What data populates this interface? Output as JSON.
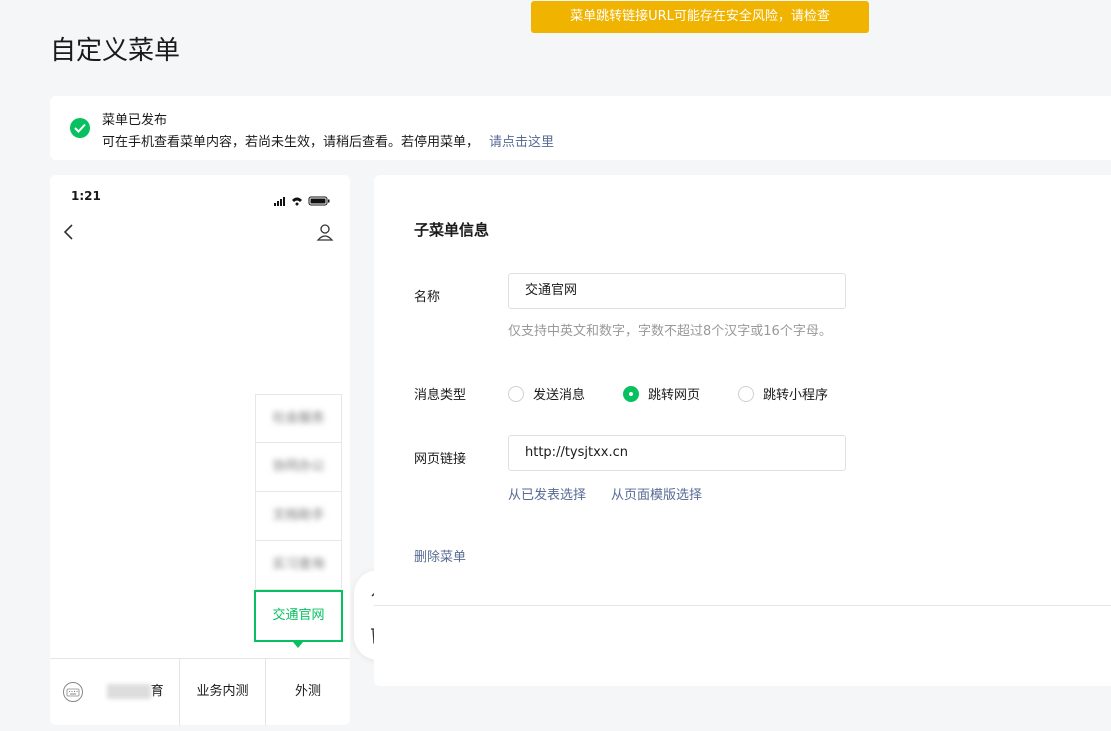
{
  "toast": "菜单跳转链接URL可能存在安全风险，请检查",
  "page_title": "自定义菜单",
  "notice": {
    "title": "菜单已发布",
    "desc": "可在手机查看菜单内容，若尚未生效，请稍后查看。若停用菜单，",
    "link": "请点击这里"
  },
  "phone": {
    "time": "1:21",
    "submenu": [
      {
        "label": "社会服务"
      },
      {
        "label": "协同办公"
      },
      {
        "label": "文档助手"
      },
      {
        "label": "实习查询"
      },
      {
        "label": "交通官网"
      }
    ],
    "bottom_menu": [
      {
        "label": "育"
      },
      {
        "label": "业务内测"
      },
      {
        "label": "外测"
      }
    ]
  },
  "form": {
    "title": "子菜单信息",
    "name_label": "名称",
    "name_value": "交通官网",
    "name_hint": "仅支持中英文和数字，字数不超过8个汉字或16个字母。",
    "type_label": "消息类型",
    "options": [
      "发送消息",
      "跳转网页",
      "跳转小程序"
    ],
    "selected_option": "跳转网页",
    "url_label": "网页链接",
    "url_value": "http://tysjtxx.cn",
    "link_published": "从已发表选择",
    "link_template": "从页面模版选择",
    "delete": "删除菜单"
  },
  "colors": {
    "accent": "#07c160",
    "link": "#576b95",
    "warning": "#f0b400"
  }
}
